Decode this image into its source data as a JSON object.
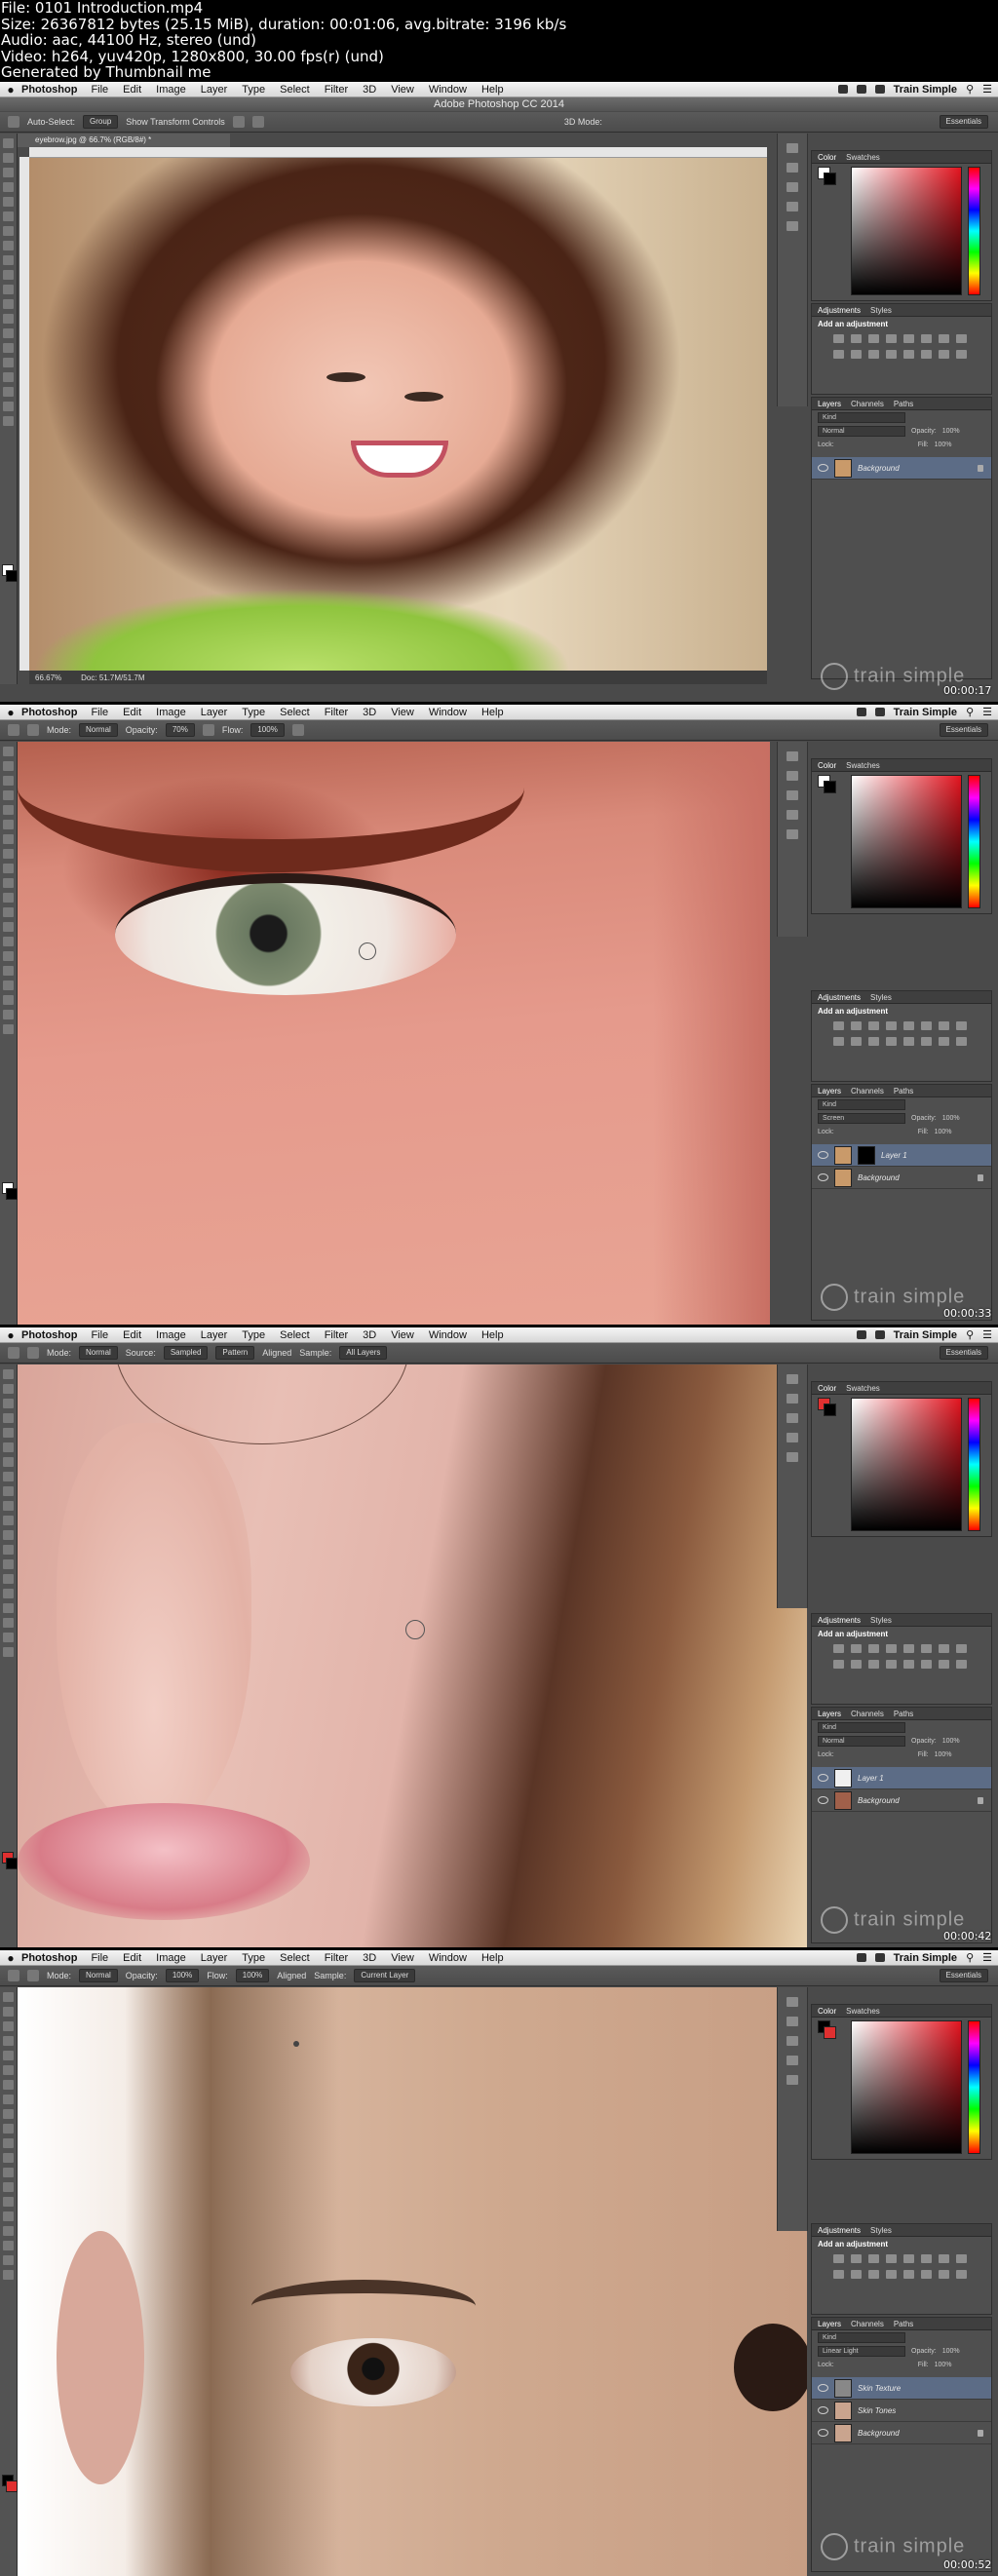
{
  "meta": {
    "file": "File: 0101 Introduction.mp4",
    "size": "Size: 26367812 bytes (25.15 MiB), duration: 00:01:06, avg.bitrate: 3196 kb/s",
    "audio": "Audio: aac, 44100 Hz, stereo (und)",
    "video": "Video: h264, yuv420p, 1280x800, 30.00 fps(r) (und)",
    "generated": "Generated by Thumbnail me"
  },
  "macmenu": {
    "app": "Photoshop",
    "items": [
      "File",
      "Edit",
      "Image",
      "Layer",
      "Type",
      "Select",
      "Filter",
      "3D",
      "View",
      "Window",
      "Help"
    ],
    "user": "Train Simple"
  },
  "ps_title": "Adobe Photoshop CC 2014",
  "workspace": "Essentials",
  "panels": {
    "color_tabs": [
      "Color",
      "Swatches"
    ],
    "adj_tabs": [
      "Adjustments",
      "Styles"
    ],
    "add_adjustment": "Add an adjustment",
    "layer_tabs": [
      "Layers",
      "Channels",
      "Paths"
    ],
    "kind": "Kind",
    "opacity_label": "Opacity:",
    "fill_label": "Fill:",
    "lock_label": "Lock:"
  },
  "frames": [
    {
      "options": [
        "Auto-Select:",
        "Group",
        "Show Transform Controls",
        "3D Mode:"
      ],
      "doc_tab": "eyebrow.jpg @ 66.7% (RGB/8#) *",
      "status_zoom": "66.67%",
      "status_doc": "Doc: 51.7M/51.7M",
      "timestamp": "00:00:17",
      "blend": "Normal",
      "opacity": "100%",
      "fill": "100%",
      "layers": [
        {
          "name": "Background",
          "selected": true
        }
      ]
    },
    {
      "options": [
        "Mode:",
        "Normal",
        "Opacity:",
        "70%",
        "Flow:",
        "100%"
      ],
      "timestamp": "00:00:33",
      "blend": "Screen",
      "opacity": "100%",
      "fill": "100%",
      "layers": [
        {
          "name": "Layer 1",
          "selected": true
        },
        {
          "name": "Background",
          "selected": false
        }
      ]
    },
    {
      "options": [
        "Mode:",
        "Normal",
        "Source:",
        "Sampled",
        "Pattern",
        "Aligned",
        "Sample:",
        "All Layers"
      ],
      "timestamp": "00:00:42",
      "blend": "Normal",
      "opacity": "100%",
      "fill": "100%",
      "layers": [
        {
          "name": "Layer 1",
          "selected": true
        },
        {
          "name": "Background",
          "selected": false
        }
      ]
    },
    {
      "options": [
        "Mode:",
        "Normal",
        "Opacity:",
        "100%",
        "Flow:",
        "100%",
        "Aligned",
        "Sample:",
        "Current Layer"
      ],
      "timestamp": "00:00:52",
      "blend": "Linear Light",
      "opacity": "100%",
      "fill": "100%",
      "layers": [
        {
          "name": "Skin Texture",
          "selected": true
        },
        {
          "name": "Skin Tones",
          "selected": false
        },
        {
          "name": "Background",
          "selected": false
        }
      ]
    }
  ],
  "watermark": "train simple",
  "colors": {
    "ui_dark": "#4a4a4a",
    "selection": "#5c6c86",
    "skin": "#e8a89a"
  }
}
